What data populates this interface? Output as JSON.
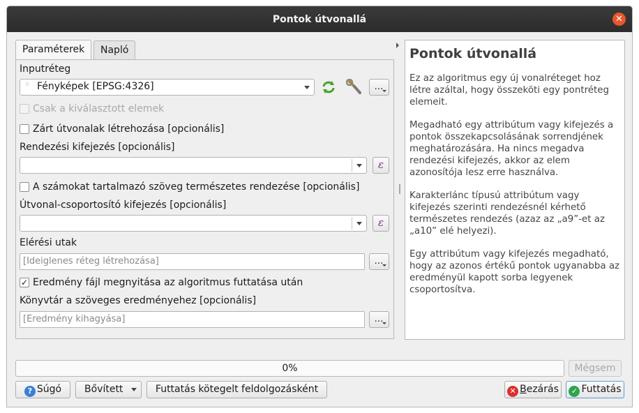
{
  "window": {
    "title": "Pontok útvonallá"
  },
  "tabs": [
    {
      "label": "Paraméterek"
    },
    {
      "label": "Napló"
    }
  ],
  "params": {
    "input_layer_label": "Inputréteg",
    "input_layer_value": "Fényképek [EPSG:4326]",
    "selected_only_label": "Csak a kiválasztott elemek",
    "closed_paths_label": "Zárt útvonalak létrehozása [opcionális]",
    "closed_paths_checked": false,
    "order_expr_label": "Rendezési kifejezés [opcionális]",
    "order_expr_value": "",
    "natural_sort_label": "A számokat tartalmazó szöveg természetes rendezése [opcionális]",
    "natural_sort_checked": false,
    "group_expr_label": "Útvonal-csoportosító kifejezés [opcionális]",
    "group_expr_value": "",
    "paths_label": "Elérési utak",
    "paths_placeholder": "[Ideiglenes réteg létrehozása]",
    "open_result_label": "Eredmény fájl megnyitása az algoritmus futtatása után",
    "open_result_checked": true,
    "check_mark": "✓",
    "dir_label": "Könyvtár a szöveges eredményehez [opcionális]",
    "dir_placeholder": "[Eredmény kihagyása]",
    "ellipsis": "…",
    "epsilon": "ε"
  },
  "help": {
    "title": "Pontok útvonallá",
    "paragraphs": [
      "Ez az algoritmus egy új vonalréteget hoz létre azáltal, hogy összeköti egy pontréteg elemeit.",
      "Megadható egy attribútum vagy kifejezés a pontok összekapcsolásának sorrendjének meghatározására. Ha nincs megadva rendezési kifejezés, akkor az elem azonosítója lesz erre használva.",
      "Karakterlánc típusú attribútum vagy kifejezés szerinti rendezésnél kérhető természetes rendezés (azaz az „a9”-et az „a10” elé helyezi).",
      "Egy attribútum vagy kifejezés megadható, hogy az azonos értékű pontok ugyanabba az eredményül kapott sorba legyenek csoportosítva."
    ]
  },
  "progress": {
    "value": 0,
    "label": "0%"
  },
  "buttons": {
    "cancel": "Mégsem",
    "help": "Súgó",
    "advanced": "Bővített",
    "batch": "Futtatás kötegelt feldolgozásként",
    "close_underlined": "B",
    "close_rest": "ezárás",
    "run": "Futtatás"
  },
  "colors": {
    "titlebar": "#2c2c2c",
    "close_button": "#e5582d",
    "epsilon": "#7a2f86",
    "help_icon": "#3a7fd6",
    "close_icon": "#d9302d",
    "run_icon": "#2ea44f"
  }
}
